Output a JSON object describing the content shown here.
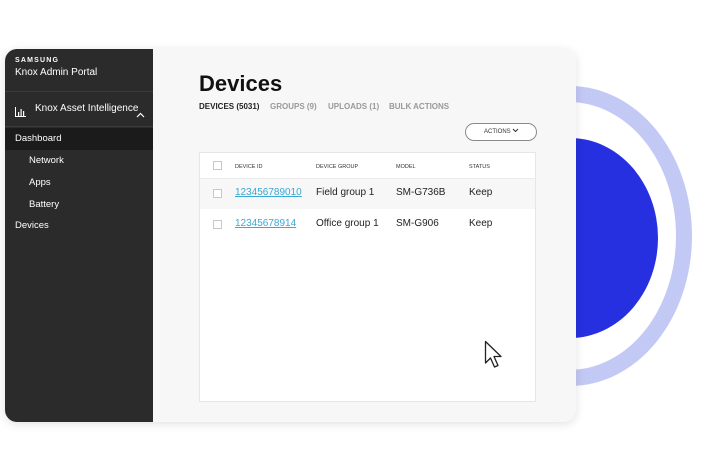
{
  "sidebar": {
    "brand": "SAMSUNG",
    "portal_title": "Knox Admin Portal",
    "section": {
      "label": "Knox Asset Intelligence",
      "icon": "bar-chart-icon",
      "expanded": true
    },
    "items": [
      {
        "label": "Dashboard",
        "active": true
      },
      {
        "label": "Network",
        "active": false
      },
      {
        "label": "Apps",
        "active": false
      },
      {
        "label": "Battery",
        "active": false
      },
      {
        "label": "Devices",
        "active": false
      }
    ]
  },
  "main": {
    "title": "Devices",
    "tabs": [
      {
        "label": "DEVICES (5031)",
        "active": true
      },
      {
        "label": "GROUPS (9)",
        "active": false
      },
      {
        "label": "UPLOADS (1)",
        "active": false
      },
      {
        "label": "BULK ACTIONS",
        "active": false
      }
    ],
    "actions_label": "ACTIONS",
    "table": {
      "columns": [
        "DEVICE ID",
        "DEVICE GROUP",
        "MODEL",
        "STATUS"
      ],
      "rows": [
        {
          "device_id": "123456789010",
          "device_group": "Field group 1",
          "model": "SM-G736B",
          "status": "Keep"
        },
        {
          "device_id": "12345678914",
          "device_group": "Office group 1",
          "model": "SM-G906",
          "status": "Keep"
        }
      ]
    }
  },
  "colors": {
    "sidebar_bg": "#2b2b2b",
    "active_nav_bg": "#1b1b1b",
    "link": "#3aa9d6",
    "ring": "#c3c9f5",
    "accent_blue": "#2630e0"
  }
}
